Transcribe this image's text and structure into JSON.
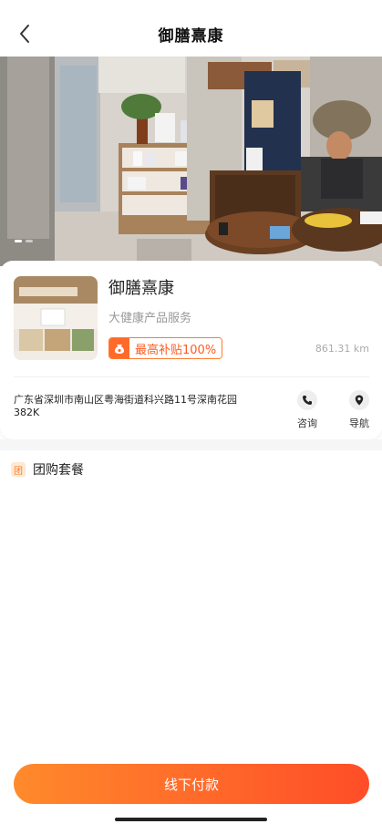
{
  "header": {
    "title": "御膳熹康"
  },
  "store": {
    "name": "御膳熹康",
    "category": "大健康产品服务",
    "subsidy_label": "最高补贴100%",
    "distance": "861.31 km",
    "address": "广东省深圳市南山区粤海街道科兴路11号深南花园382K"
  },
  "actions": {
    "consult_label": "咨询",
    "navigate_label": "导航"
  },
  "section": {
    "icon_text": "团",
    "title": "团购套餐"
  },
  "footer": {
    "pay_label": "线下付款"
  },
  "colors": {
    "accent": "#ff5a1f",
    "gradient_start": "#ff8a2b",
    "gradient_end": "#ff4d28"
  },
  "icons": {
    "back": "chevron-left-icon",
    "phone": "phone-icon",
    "location": "location-pin-icon",
    "subsidy": "coin-bag-icon"
  }
}
